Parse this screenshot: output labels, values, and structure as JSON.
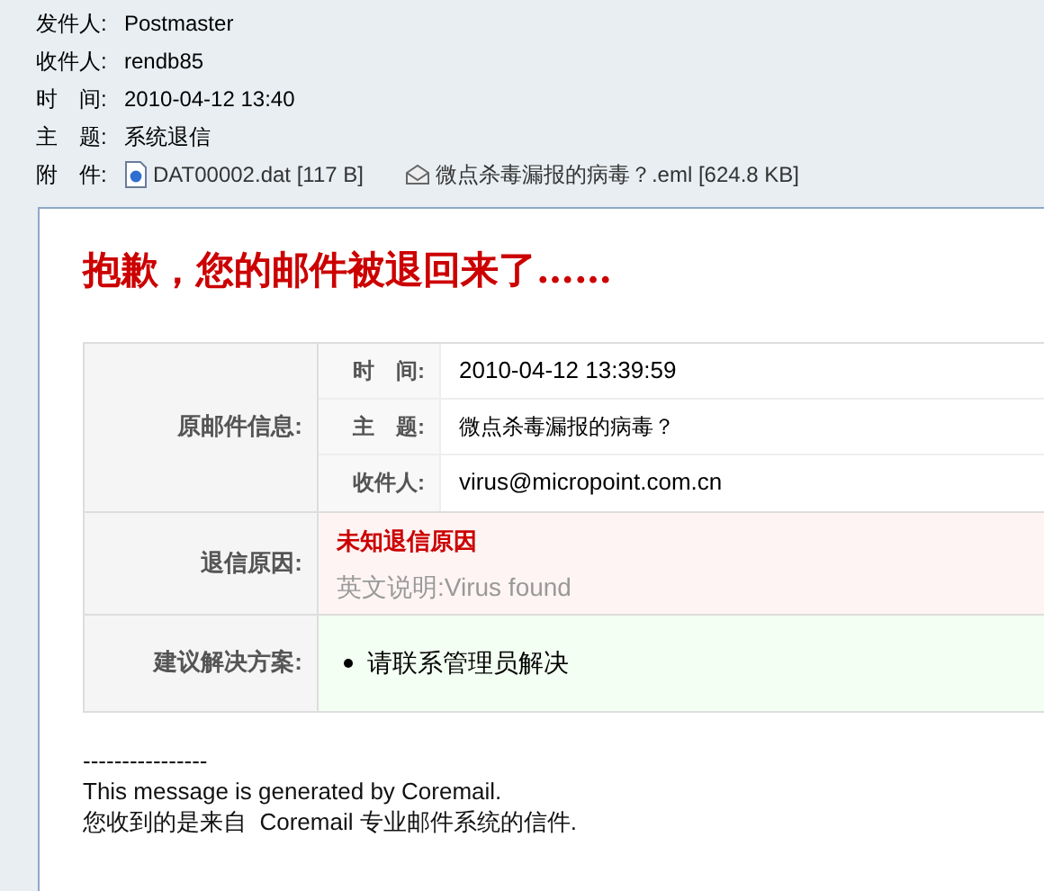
{
  "header": {
    "fields": [
      {
        "label": "发件人:",
        "value": "Postmaster"
      },
      {
        "label": "收件人:",
        "value": "rendb85"
      },
      {
        "label": "时　间:",
        "value": "2010-04-12 13:40"
      },
      {
        "label": "主　题:",
        "value": "系统退信"
      }
    ],
    "attachments": {
      "label": "附　件:",
      "items": [
        {
          "kind": "dat",
          "name": "DAT00002.dat [117 B]"
        },
        {
          "kind": "eml",
          "name": "微点杀毒漏报的病毒？.eml [624.8 KB]"
        }
      ]
    }
  },
  "message": {
    "title": "抱歉，您的邮件被退回来了……",
    "original": {
      "label": "原邮件信息:",
      "rows": [
        {
          "label": "时　间:",
          "value": "2010-04-12 13:39:59"
        },
        {
          "label": "主　题:",
          "value": "微点杀毒漏报的病毒？"
        },
        {
          "label": "收件人:",
          "value": "virus@micropoint.com.cn"
        }
      ]
    },
    "reason": {
      "label": "退信原因:",
      "title": "未知退信原因",
      "detail": "英文说明:Virus found"
    },
    "suggestion": {
      "label": "建议解决方案:",
      "items": [
        "请联系管理员解决"
      ]
    },
    "footer": [
      "----------------",
      "This message is generated by Coremail.",
      "您收到的是来自  Coremail 专业邮件系统的信件."
    ]
  }
}
